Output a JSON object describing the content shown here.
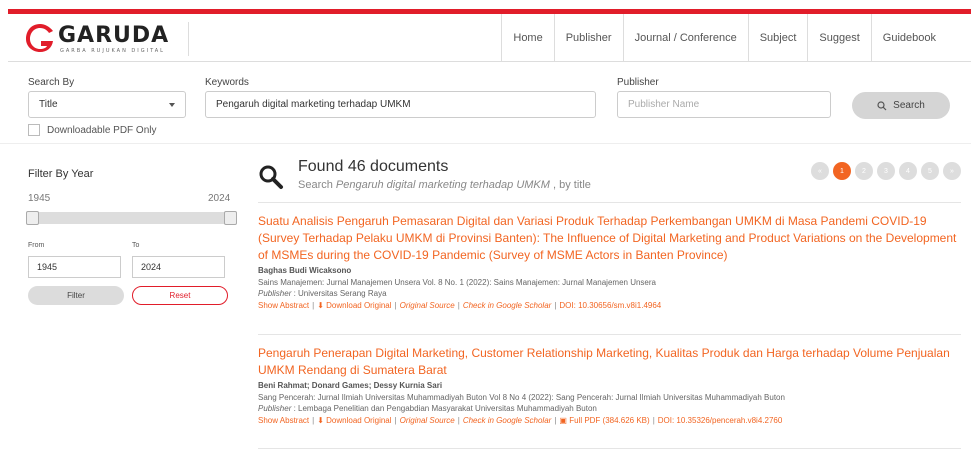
{
  "brand": {
    "name": "GARUDA",
    "tagline": "GARBA RUJUKAN DIGITAL"
  },
  "nav": [
    "Home",
    "Publisher",
    "Journal / Conference",
    "Subject",
    "Suggest",
    "Guidebook"
  ],
  "search": {
    "search_by_label": "Search By",
    "search_by_value": "Title",
    "keywords_label": "Keywords",
    "keywords_value": "Pengaruh digital marketing terhadap UMKM",
    "publisher_label": "Publisher",
    "publisher_placeholder": "Publisher Name",
    "button": "Search",
    "pdf_only": "Downloadable PDF Only"
  },
  "filter": {
    "title": "Filter By Year",
    "min": "1945",
    "max": "2024",
    "from_label": "From",
    "to_label": "To",
    "from_value": "1945",
    "to_value": "2024",
    "filter_btn": "Filter",
    "reset_btn": "Reset"
  },
  "results": {
    "found": "Found 46 documents",
    "sub_prefix": "Search ",
    "sub_query": "Pengaruh digital marketing terhadap UMKM",
    "sub_suffix": " , by title",
    "pages": [
      "«",
      "1",
      "2",
      "3",
      "4",
      "5",
      "»"
    ]
  },
  "articles": [
    {
      "title": "Suatu Analisis Pengaruh Pemasaran Digital dan Variasi Produk Terhadap Perkembangan UMKM di Masa Pandemi COVID-19 (Survey Terhadap Pelaku UMKM di Provinsi Banten): The Influence of Digital Marketing and Product Variations on the Development of MSMEs during the COVID-19 Pandemic (Survey of MSME Actors in Banten Province)",
      "authors": "Baghas Budi Wicaksono",
      "journal": "Sains Manajemen: Jurnal Manajemen Unsera Vol. 8 No. 1 (2022): Sains Manajemen: Jurnal Manajemen Unsera",
      "publisher_label": "Publisher",
      "publisher": " : Universitas Serang Raya",
      "show_abstract": "Show Abstract",
      "download": "Download Original",
      "source": "Original Source",
      "scholar": "Check in Google Scholar",
      "full_pdf": "",
      "doi": "DOI: 10.30656/sm.v8i1.4964"
    },
    {
      "title": "Pengaruh Penerapan Digital Marketing, Customer Relationship Marketing, Kualitas Produk dan Harga terhadap Volume Penjualan UMKM Rendang di Sumatera Barat",
      "authors": "Beni Rahmat; Donard Games; Dessy Kurnia Sari",
      "journal": "Sang Pencerah: Jurnal Ilmiah Universitas Muhammadiyah Buton Vol 8 No 4 (2022): Sang Pencerah: Jurnal Ilmiah Universitas Muhammadiyah Buton",
      "publisher_label": "Publisher",
      "publisher": " : Lembaga Penelitian dan Pengabdian Masyarakat Universitas Muhammadiyah Buton",
      "show_abstract": "Show Abstract",
      "download": "Download Original",
      "source": "Original Source",
      "scholar": "Check in Google Scholar",
      "full_pdf": "Full PDF (384.626 KB)",
      "doi": "DOI: 10.35326/pencerah.v8i4.2760"
    }
  ],
  "colors": {
    "brand_red": "#e11d2a",
    "accent_orange": "#f26522"
  }
}
